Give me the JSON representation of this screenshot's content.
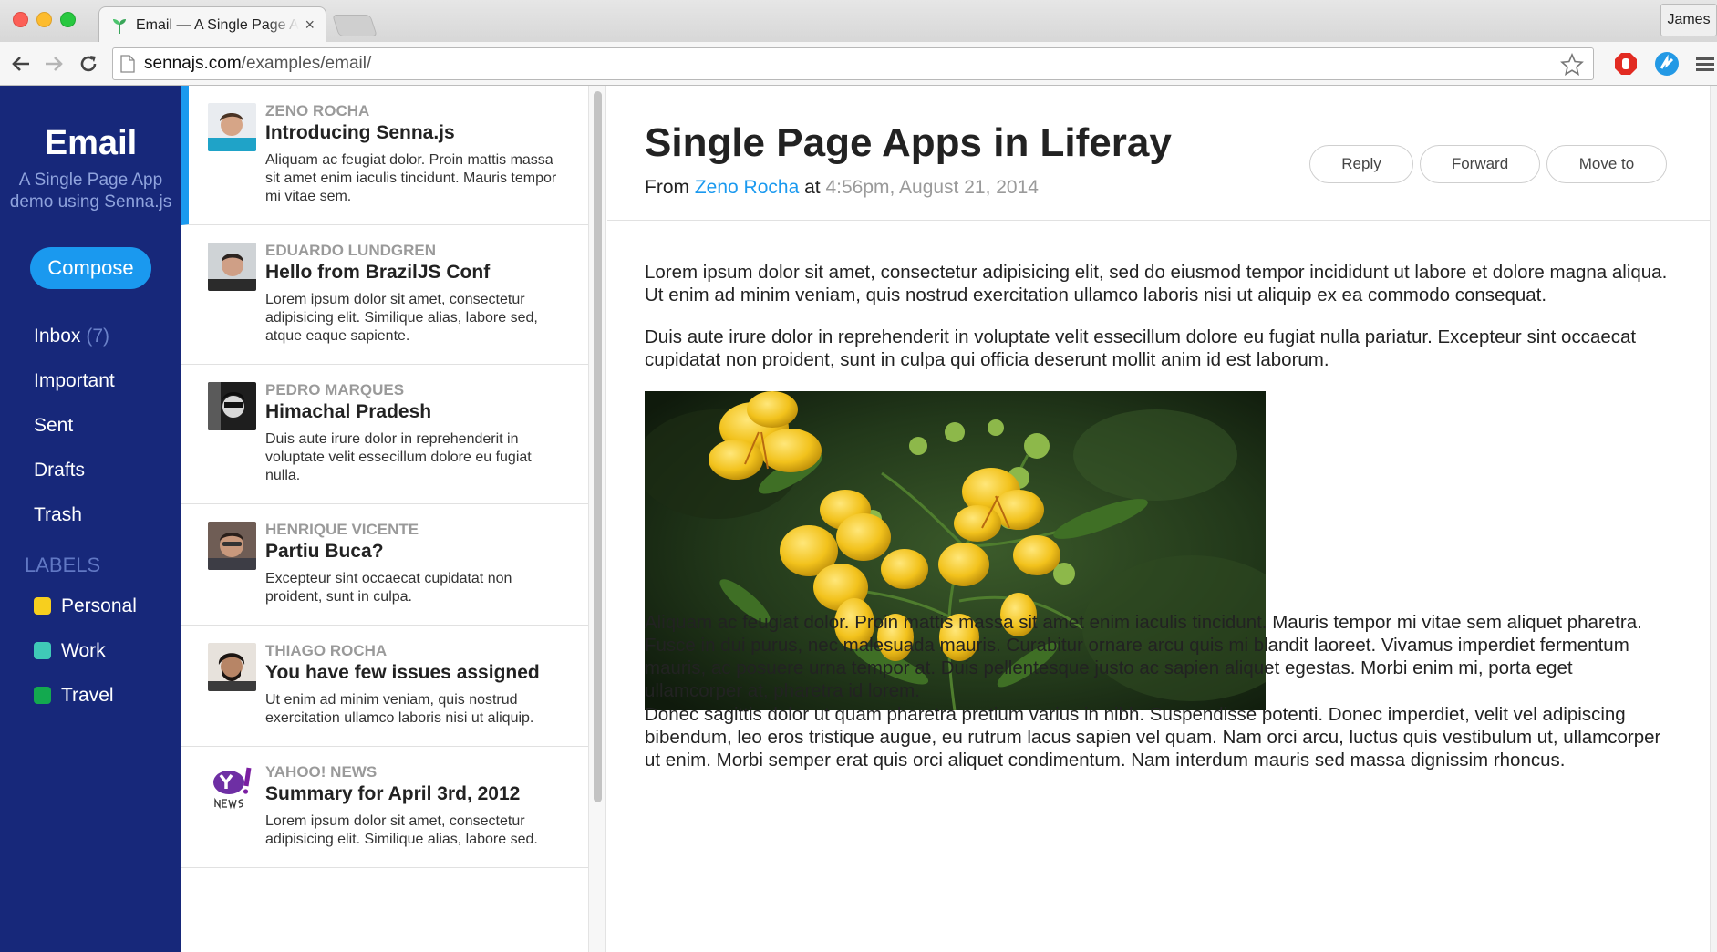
{
  "browser": {
    "tab_title": "Email — A Single Page App demo using Senna.js",
    "tab_close": "×",
    "profile_name": "James",
    "url_host": "sennajs.com",
    "url_path": "/examples/email/"
  },
  "sidebar": {
    "brand_title": "Email",
    "brand_subtitle_line1": "A Single Page App",
    "brand_subtitle_line2": "demo using Senna.js",
    "compose_label": "Compose",
    "nav": [
      {
        "label": "Inbox",
        "count": "(7)"
      },
      {
        "label": "Important",
        "count": ""
      },
      {
        "label": "Sent",
        "count": ""
      },
      {
        "label": "Drafts",
        "count": ""
      },
      {
        "label": "Trash",
        "count": ""
      }
    ],
    "labels_heading": "LABELS",
    "labels": [
      {
        "name": "Personal",
        "color": "#f7cf1e"
      },
      {
        "name": "Work",
        "color": "#3fc9b7"
      },
      {
        "name": "Travel",
        "color": "#13a94f"
      }
    ]
  },
  "mail_list": [
    {
      "sender": "Zeno Rocha",
      "subject": "Introducing Senna.js",
      "snippet": "Aliquam ac feugiat dolor. Proin mattis massa sit amet enim iaculis tincidunt. Mauris tempor mi vitae sem."
    },
    {
      "sender": "Eduardo Lundgren",
      "subject": "Hello from BrazilJS Conf",
      "snippet": "Lorem ipsum dolor sit amet, consectetur adipisicing elit. Similique alias, labore sed, atque eaque sapiente."
    },
    {
      "sender": "Pedro Marques",
      "subject": "Himachal Pradesh",
      "snippet": "Duis aute irure dolor in reprehenderit in voluptate velit essecillum dolore eu fugiat nulla."
    },
    {
      "sender": "Henrique Vicente",
      "subject": "Partiu Buca?",
      "snippet": "Excepteur sint occaecat cupidatat non proident, sunt in culpa."
    },
    {
      "sender": "Thiago Rocha",
      "subject": "You have few issues assigned",
      "snippet": "Ut enim ad minim veniam, quis nostrud exercitation ullamco laboris nisi ut aliquip."
    },
    {
      "sender": "Yahoo! News",
      "subject": "Summary for April 3rd, 2012",
      "snippet": "Lorem ipsum dolor sit amet, consectetur adipisicing elit. Similique alias, labore sed."
    }
  ],
  "reader": {
    "title": "Single Page Apps in Liferay",
    "from_prefix": "From",
    "from_name": "Zeno Rocha",
    "at_word": "at",
    "date": "4:56pm, August 21, 2014",
    "actions": {
      "reply": "Reply",
      "forward": "Forward",
      "move": "Move to"
    },
    "paragraphs": [
      "Lorem ipsum dolor sit amet, consectetur adipisicing elit, sed do eiusmod tempor incididunt ut labore et dolore magna aliqua. Ut enim ad minim veniam, quis nostrud exercitation ullamco laboris nisi ut aliquip ex ea commodo consequat.",
      "Duis aute irure dolor in reprehenderit in voluptate velit essecillum dolore eu fugiat nulla pariatur. Excepteur sint occaecat cupidatat non proident, sunt in culpa qui officia deserunt mollit anim id est laborum.",
      "Aliquam ac feugiat dolor. Proin mattis massa sit amet enim iaculis tincidunt. Mauris tempor mi vitae sem aliquet pharetra. Fusce in dui purus, nec malesuada mauris. Curabitur ornare arcu quis mi blandit laoreet. Vivamus imperdiet fermentum mauris, ac posuere urna tempor at. Duis pellentesque justo ac sapien aliquet egestas. Morbi enim mi, porta eget ullamcorper at, pharetra id lorem.",
      "Donec sagittis dolor ut quam pharetra pretium varius in nibh. Suspendisse potenti. Donec imperdiet, velit vel adipiscing bibendum, leo eros tristique augue, eu rutrum lacus sapien vel quam. Nam orci arcu, luctus quis vestibulum ut, ullamcorper ut enim. Morbi semper erat quis orci aliquet condimentum. Nam interdum mauris sed massa dignissim rhoncus."
    ]
  }
}
